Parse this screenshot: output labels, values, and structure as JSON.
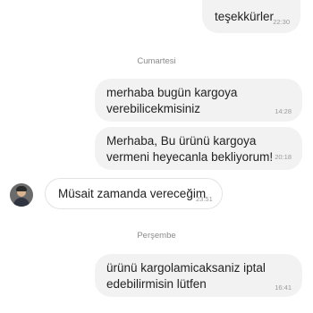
{
  "messages": [
    {
      "text": "teşekkürler",
      "time": "22:30"
    },
    {
      "text": "merhaba bugün kargoya verebilicekmisiniz",
      "time": "14:28"
    },
    {
      "text": "Merhaba, Bu ürünü kargoya vermeni heyecanla bekliyorum!",
      "time": "20:18"
    },
    {
      "text": "Müsait zamanda vereceğim",
      "time": "23:51"
    },
    {
      "text": "ürünü kargolamicaksaniz iptal edebilirmisin lütfen",
      "time": "16:41"
    }
  ],
  "dividers": [
    "Cumartesi",
    "Perşembe"
  ]
}
